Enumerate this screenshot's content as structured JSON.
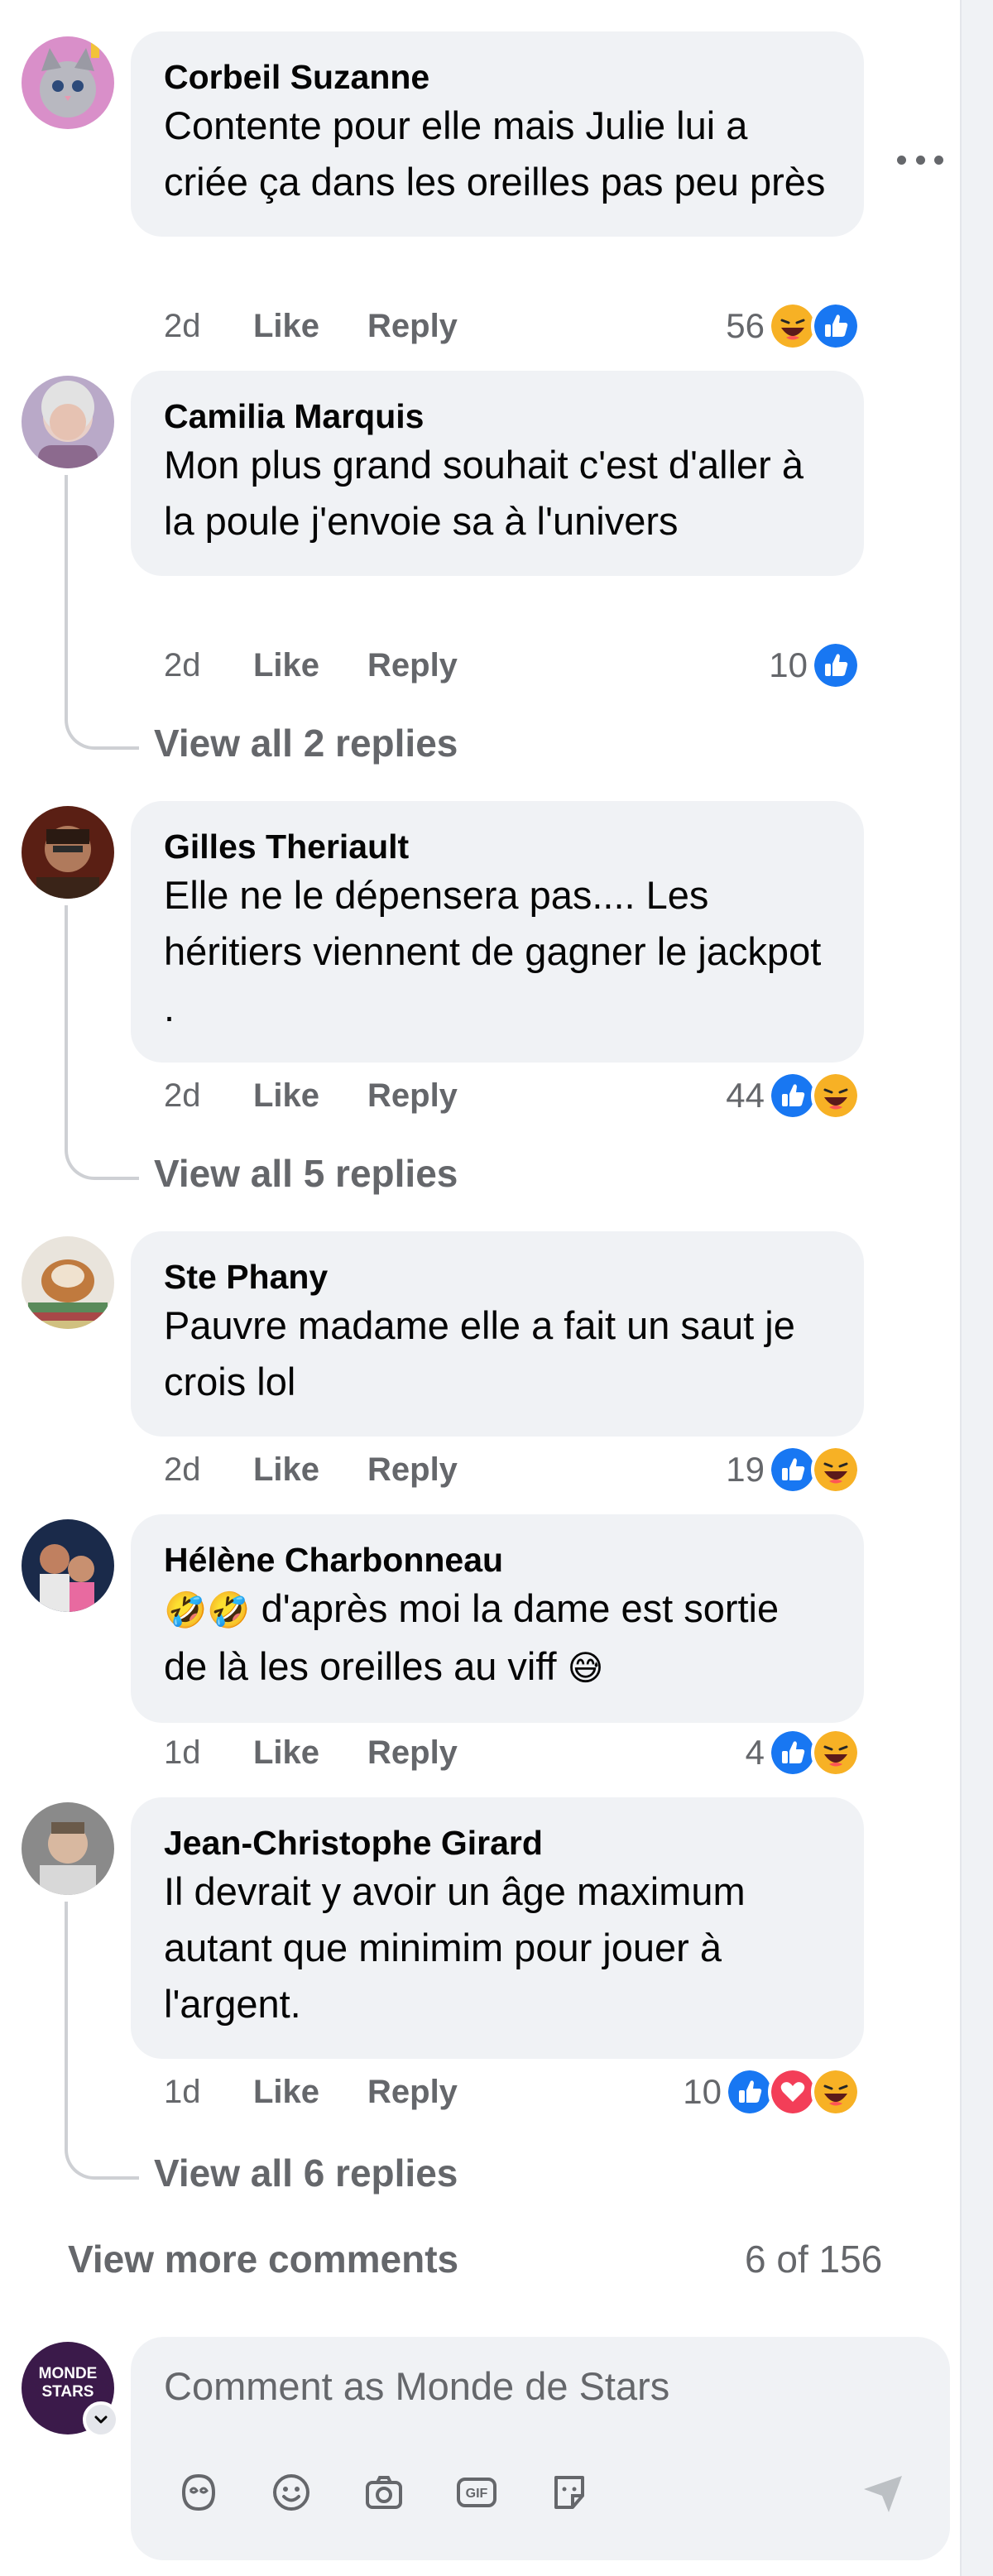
{
  "comments": [
    {
      "author": "Corbeil Suzanne",
      "text": "Contente pour elle mais Julie lui a criée ça dans les oreilles pas peu près",
      "time": "2d",
      "like": "Like",
      "reply": "Reply",
      "reaction_count": "56",
      "reactions": [
        "haha",
        "like"
      ]
    },
    {
      "author": "Camilia Marquis",
      "text": "Mon plus grand souhait c'est d'aller à la poule j'envoie sa à l'univers",
      "time": "2d",
      "like": "Like",
      "reply": "Reply",
      "reaction_count": "10",
      "reactions": [
        "like"
      ],
      "replies_link": "View all 2 replies"
    },
    {
      "author": "Gilles Theriault",
      "text": "Elle ne le dépensera pas.... Les héritiers viennent de gagner le jackpot .",
      "time": "2d",
      "like": "Like",
      "reply": "Reply",
      "reaction_count": "44",
      "reactions": [
        "like",
        "haha"
      ],
      "replies_link": "View all 5 replies"
    },
    {
      "author": "Ste Phany",
      "text": "Pauvre madame elle a fait un saut je crois lol",
      "time": "2d",
      "like": "Like",
      "reply": "Reply",
      "reaction_count": "19",
      "reactions": [
        "like",
        "haha"
      ]
    },
    {
      "author": "Hélène Charbonneau",
      "text_emoji_lead": "🤣🤣",
      "text": " d'après moi la dame est sortie de là les oreilles au viff ",
      "text_emoji_tail": "😅",
      "time": "1d",
      "like": "Like",
      "reply": "Reply",
      "reaction_count": "4",
      "reactions": [
        "like",
        "haha"
      ]
    },
    {
      "author": "Jean-Christophe Girard",
      "text": "Il devrait y avoir un âge maximum autant que minimim pour jouer à l'argent.",
      "time": "1d",
      "like": "Like",
      "reply": "Reply",
      "reaction_count": "10",
      "reactions": [
        "like",
        "love",
        "haha"
      ],
      "replies_link": "View all 6 replies"
    }
  ],
  "footer": {
    "view_more": "View more comments",
    "pager": "6 of 156"
  },
  "composer": {
    "placeholder": "Comment as Monde de Stars",
    "page_avatar_line1": "MONDE",
    "page_avatar_line2": "STARS"
  },
  "icons": {
    "tools": [
      "avatar-sticker-icon",
      "emoji-icon",
      "camera-icon",
      "gif-icon",
      "sticker-icon"
    ],
    "send": "send-icon"
  },
  "colors": {
    "like_blue": "#1877f2",
    "love_red": "#f33e58",
    "haha_yellow": "#f7b125",
    "bubble_bg": "#f0f2f5",
    "meta_gray": "#65676b"
  }
}
